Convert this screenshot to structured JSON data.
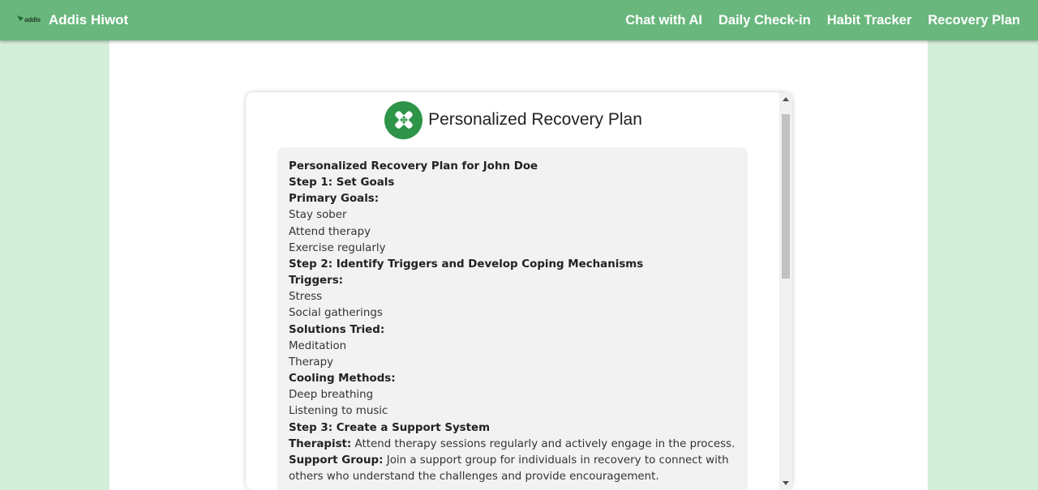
{
  "navbar": {
    "logo_text": "addis",
    "brand_name": "Addis Hiwot",
    "links": [
      "Chat with AI",
      "Daily Check-in",
      "Habit Tracker",
      "Recovery Plan"
    ]
  },
  "card": {
    "icon": "bandage-icon",
    "title": "Personalized Recovery Plan"
  },
  "plan": {
    "heading": "Personalized Recovery Plan for John Doe",
    "step1": "Step 1: Set Goals",
    "primary_goals_label": "Primary Goals:",
    "primary_goals": [
      "Stay sober",
      "Attend therapy",
      "Exercise regularly"
    ],
    "step2": "Step 2: Identify Triggers and Develop Coping Mechanisms",
    "triggers_label": "Triggers:",
    "triggers": [
      "Stress",
      "Social gatherings"
    ],
    "solutions_label": "Solutions Tried:",
    "solutions": [
      "Meditation",
      "Therapy"
    ],
    "cooling_label": "Cooling Methods:",
    "cooling": [
      "Deep breathing",
      "Listening to music"
    ],
    "step3": "Step 3: Create a Support System",
    "therapist_label": "Therapist:",
    "therapist_text": " Attend therapy sessions regularly and actively engage in the process.",
    "support_label": "Support Group:",
    "support_text": " Join a support group for individuals in recovery to connect with",
    "support_text_2": "others who understand the challenges and provide encouragement."
  },
  "colors": {
    "navbar": "#6ab77e",
    "page_background": "#d4efd9",
    "icon_circle": "#2e9448",
    "plan_box": "#f2f2f2"
  }
}
